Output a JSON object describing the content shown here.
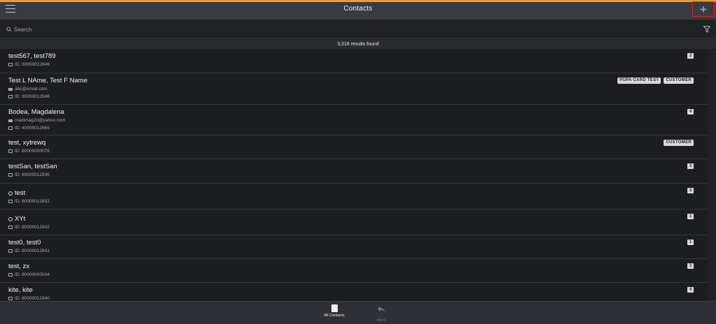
{
  "header": {
    "title": "Contacts",
    "add_label": "+"
  },
  "search": {
    "placeholder": "Search"
  },
  "results": {
    "text": "3,318 results found"
  },
  "contacts": [
    {
      "name": "test567, test789",
      "email": "",
      "id": "ID: 80000012849",
      "badges": [],
      "count": "2"
    },
    {
      "name": "Test L NAme, Test F Name",
      "email": "abc@email.com",
      "id": "ID: 80000012848",
      "badges": [
        "PUPA CARD TEST",
        "CUSTOMER"
      ],
      "count": ""
    },
    {
      "name": "Bodea, Magdalena",
      "email": "madimag20@yahoo.com",
      "id": "ID: 40000012665",
      "badges": [],
      "count": "4"
    },
    {
      "name": "test, xytrewq",
      "email": "",
      "id": "ID: 80000000076",
      "badges": [
        "CUSTOMER"
      ],
      "count": ""
    },
    {
      "name": "testSan, testSan",
      "email": "",
      "id": "ID: 80000012836",
      "badges": [],
      "count": "3"
    },
    {
      "name": "test",
      "email": "",
      "id": "ID: 80000012833",
      "badges": [],
      "count": "3"
    },
    {
      "name": "XYt",
      "email": "",
      "id": "ID: 80000012842",
      "badges": [],
      "count": "1"
    },
    {
      "name": "test0, test0",
      "email": "",
      "id": "ID: 80000012841",
      "badges": [],
      "count": "1"
    },
    {
      "name": "test, zx",
      "email": "",
      "id": "ID: 80000000034",
      "badges": [],
      "count": "3"
    },
    {
      "name": "kite, kite",
      "email": "",
      "id": "ID: 80000012840",
      "badges": [],
      "count": "4"
    }
  ],
  "tabs": {
    "all_contacts": "All Contacts",
    "more": "More"
  },
  "colors": {
    "accent": "#f39c21",
    "add_icon": "#5aa3ff",
    "highlight_border": "#d4262b"
  }
}
